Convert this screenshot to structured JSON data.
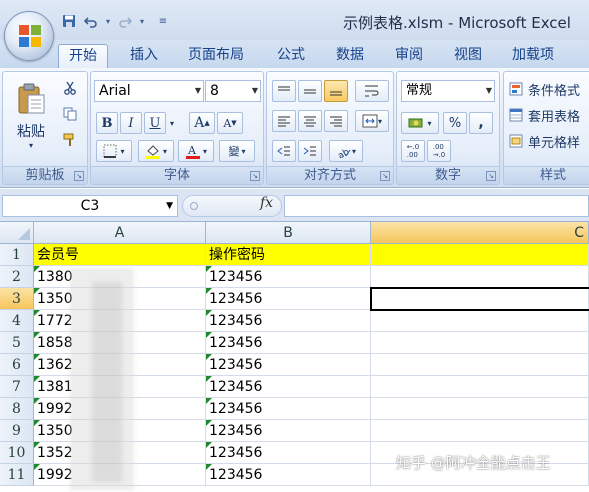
{
  "window": {
    "title": "示例表格.xlsm - Microsoft Excel"
  },
  "qat": {
    "save_icon": "save-icon",
    "undo_icon": "undo-icon",
    "redo_icon": "redo-icon",
    "more": "▾"
  },
  "tabs": [
    {
      "label": "开始",
      "active": true
    },
    {
      "label": "插入"
    },
    {
      "label": "页面布局"
    },
    {
      "label": "公式"
    },
    {
      "label": "数据"
    },
    {
      "label": "审阅"
    },
    {
      "label": "视图"
    },
    {
      "label": "加载项"
    }
  ],
  "ribbon": {
    "clipboard": {
      "label": "剪贴板",
      "paste": "粘贴"
    },
    "font": {
      "label": "字体",
      "name": "Arial",
      "size": "8",
      "bold": "B",
      "italic": "I",
      "underline": "U",
      "grow": "A",
      "shrink": "A",
      "wen": "變"
    },
    "alignment": {
      "label": "对齐方式"
    },
    "number": {
      "label": "数字",
      "format": "常规",
      "percent": "%",
      "comma": ",",
      "inc_decimal": "+.0 .00",
      "dec_decimal": ".00 →.0"
    },
    "styles": {
      "label": "样式",
      "conditional": "条件格式",
      "table": "套用表格",
      "cell": "单元格样"
    }
  },
  "formula_bar": {
    "name_box": "C3",
    "fx": "fx",
    "value": ""
  },
  "grid": {
    "columns": [
      "A",
      "B",
      "C"
    ],
    "selected_column": "C",
    "selected_row": "3",
    "rows": [
      {
        "n": "1",
        "a": "会员号",
        "b": "操作密码"
      },
      {
        "n": "2",
        "a": "1380",
        "b": "123456"
      },
      {
        "n": "3",
        "a": "1350",
        "b": "123456"
      },
      {
        "n": "4",
        "a": "1772",
        "b": "123456"
      },
      {
        "n": "5",
        "a": "1858",
        "b": "123456"
      },
      {
        "n": "6",
        "a": "1362",
        "b": "123456"
      },
      {
        "n": "7",
        "a": "1381",
        "b": "123456"
      },
      {
        "n": "8",
        "a": "1992",
        "b": "123456"
      },
      {
        "n": "9",
        "a": "1350",
        "b": "123456"
      },
      {
        "n": "10",
        "a": "1352",
        "b": "123456"
      },
      {
        "n": "11",
        "a": "1992",
        "b": "123456"
      }
    ]
  },
  "watermark": "知乎 @阿冲全能点击王",
  "colors": {
    "header_highlight": "#ffff00",
    "selection": "#f7c65c",
    "ribbon_blue": "#15428b"
  }
}
